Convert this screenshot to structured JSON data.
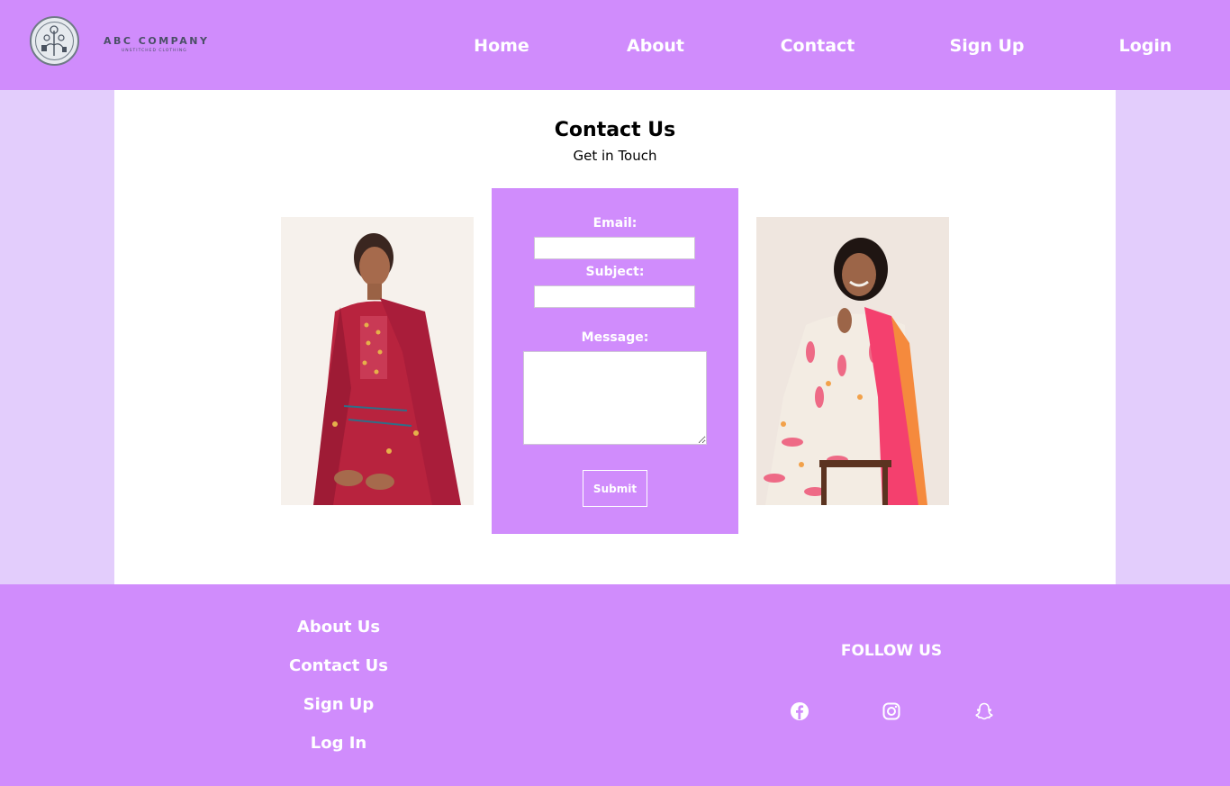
{
  "brand": {
    "name": "ABC COMPANY",
    "tagline": "UNSTITCHED CLOTHING"
  },
  "nav": {
    "home": "Home",
    "about": "About",
    "contact": "Contact",
    "signup": "Sign Up",
    "login": "Login"
  },
  "page": {
    "title": "Contact Us",
    "subtitle": "Get in Touch"
  },
  "form": {
    "email_label": "Email:",
    "email_value": "",
    "subject_label": "Subject:",
    "subject_value": "",
    "message_label": "Message:",
    "message_value": "",
    "submit_label": "Submit"
  },
  "footer": {
    "links": {
      "about": "About Us",
      "contact": "Contact Us",
      "signup": "Sign Up",
      "login": "Log In"
    },
    "follow_heading": "FOLLOW US",
    "social_icons": [
      "facebook-icon",
      "instagram-icon",
      "snapchat-icon"
    ]
  },
  "colors": {
    "accent": "#d08cfc",
    "page_bg": "#e3cdfc",
    "content_bg": "#ffffff",
    "text_on_accent": "#ffffff"
  }
}
